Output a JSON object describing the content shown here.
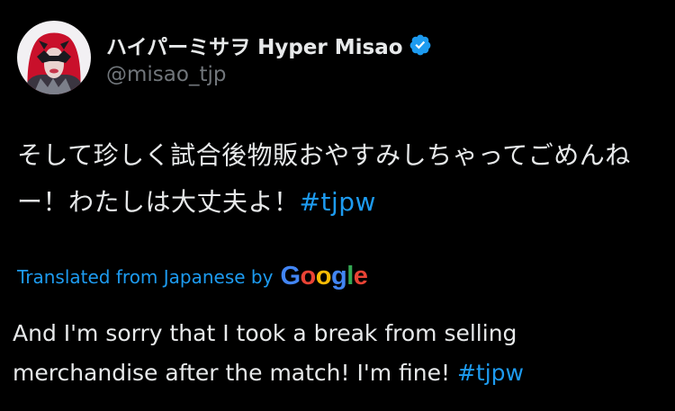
{
  "tweet": {
    "author": {
      "display_name": "ハイパーミサヲ Hyper Misao",
      "handle": "@misao_tjp",
      "verified": true,
      "avatar_icon": "profile-avatar"
    },
    "original_text": "そして珍しく試合後物販おやすみしちゃってごめんねー！わたしは大丈夫よ！",
    "original_hashtag": "#tjpw",
    "translation_label": "Translated from Japanese by",
    "translation_provider": "Google",
    "translated_text": "And I'm sorry that I took a break from selling merchandise after the match! I'm fine!",
    "translated_hashtag": "#tjpw"
  },
  "colors": {
    "background": "#000000",
    "text": "#e7e9ea",
    "muted": "#71767b",
    "accent": "#1d9bf0"
  }
}
